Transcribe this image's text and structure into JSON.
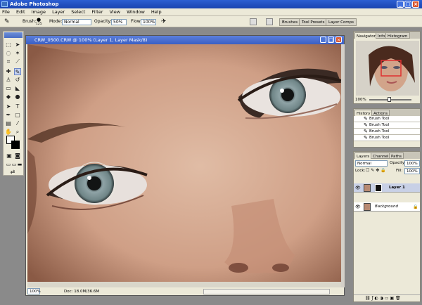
{
  "app": {
    "title": "Adobe Photoshop"
  },
  "menu": [
    "File",
    "Edit",
    "Image",
    "Layer",
    "Select",
    "Filter",
    "View",
    "Window",
    "Help"
  ],
  "options": {
    "brush_label": "Brush:",
    "brush_size": "125",
    "mode_label": "Mode:",
    "mode_value": "Normal",
    "opacity_label": "Opacity:",
    "opacity_value": "50%",
    "flow_label": "Flow:",
    "flow_value": "100%"
  },
  "well_tabs": [
    "Brushes",
    "Tool Presets",
    "Layer Comps"
  ],
  "document": {
    "title": "CRW_0500.CRW @ 100% (Layer 1, Layer Mask/8)",
    "zoom": "100%",
    "doc_info": "Doc: 18.0M/36.6M"
  },
  "navigator": {
    "tabs": [
      "Navigator",
      "Info",
      "Histogram"
    ],
    "zoom": "100%"
  },
  "history": {
    "tabs": [
      "History",
      "Actions"
    ],
    "items": [
      "Brush Tool",
      "Brush Tool",
      "Brush Tool",
      "Brush Tool"
    ]
  },
  "layers": {
    "tabs": [
      "Layers",
      "Channels",
      "Paths"
    ],
    "blend_mode": "Normal",
    "opacity_label": "Opacity:",
    "opacity_value": "100%",
    "lock_label": "Lock:",
    "fill_label": "Fill:",
    "fill_value": "100%",
    "items": [
      "Layer 1",
      "Background"
    ]
  },
  "colors": {
    "titlebar": "#2c5fd2",
    "ui": "#ece9d8"
  }
}
